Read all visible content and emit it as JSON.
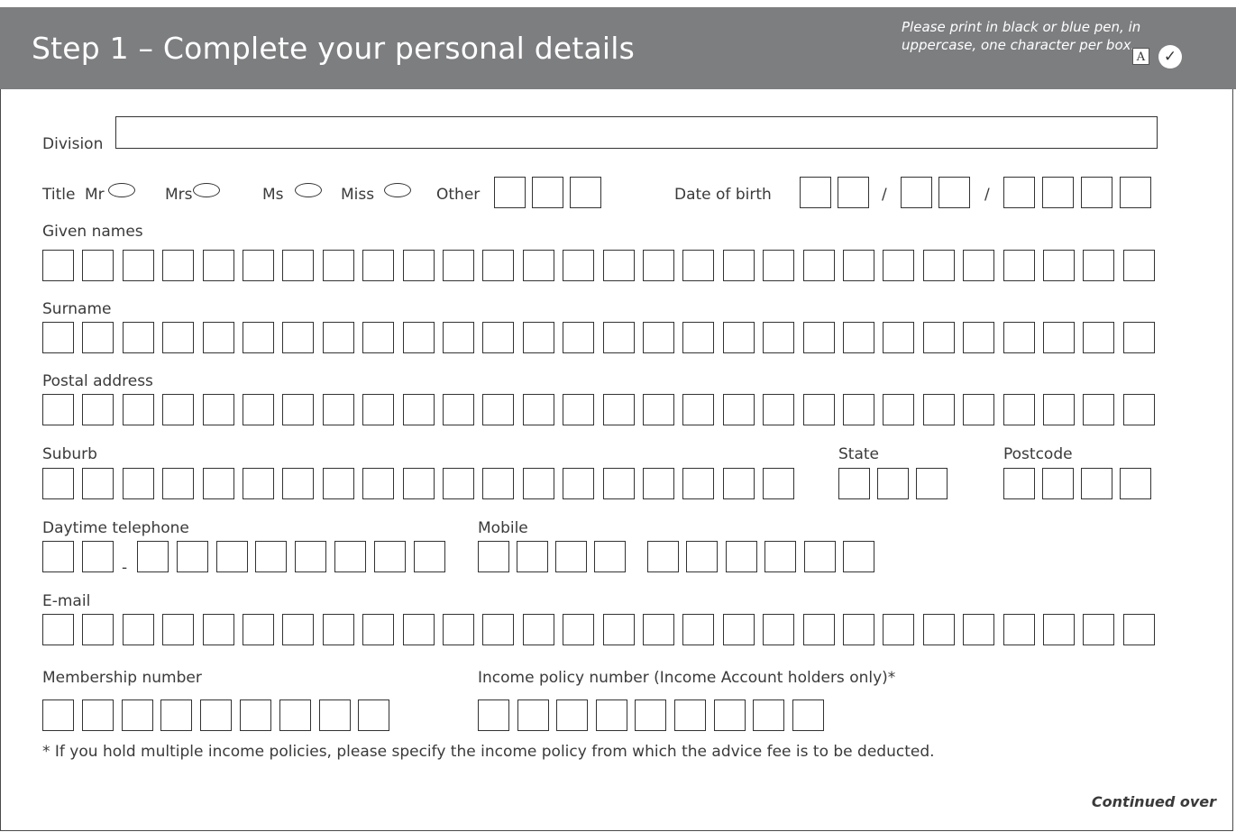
{
  "header": {
    "title": "Step 1 – Complete your personal details",
    "instructions": "Please print in black or blue pen, in uppercase, one character per box.",
    "example_letter": "A",
    "example_tick": "✓",
    "color": "#7d7e80"
  },
  "labels": {
    "division": "Division",
    "title": "Title",
    "mr": "Mr",
    "mrs": "Mrs",
    "ms": "Ms",
    "miss": "Miss",
    "other": "Other",
    "dob": "Date of birth",
    "dob_sep": "/",
    "given_names": "Given names",
    "surname": "Surname",
    "postal_address": "Postal address",
    "suburb": "Suburb",
    "state": "State",
    "postcode": "Postcode",
    "daytime_phone": "Daytime telephone",
    "phone_sep": "-",
    "mobile": "Mobile",
    "email": "E-mail",
    "membership": "Membership number",
    "income_policy": "Income policy number (Income Account holders only)*"
  },
  "footnote": "* If you hold multiple income policies, please specify the income policy from which the advice fee is to be deducted.",
  "continued": "Continued over"
}
